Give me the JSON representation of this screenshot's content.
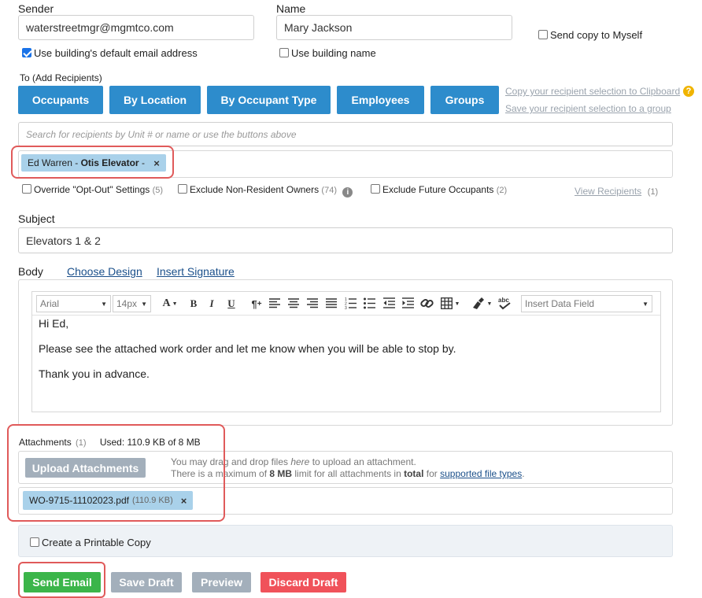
{
  "sender": {
    "label": "Sender",
    "email": "waterstreetmgr@mgmtco.com",
    "default_email_label": "Use building's default email address",
    "default_email_checked": true
  },
  "name": {
    "label": "Name",
    "value": "Mary Jackson",
    "use_building_label": "Use building name",
    "use_building_checked": false
  },
  "send_copy_label": "Send copy to Myself",
  "recipients": {
    "label": "To (Add Recipients)",
    "buttons": [
      "Occupants",
      "By Location",
      "By Occupant Type",
      "Employees",
      "Groups"
    ],
    "copy_link": "Copy your recipient selection to Clipboard",
    "save_link": "Save your recipient selection to a group",
    "help_glyph": "?",
    "search_placeholder": "Search for recipients by Unit # or name or use the buttons above",
    "chip": {
      "name": "Ed Warren",
      "sep": " - ",
      "company": "Otis Elevator",
      "tail": " - ",
      "remove": "×"
    },
    "options": [
      {
        "label": "Override \"Opt-Out\" Settings",
        "count": "(5)"
      },
      {
        "label": "Exclude Non-Resident Owners",
        "count": "(74)",
        "info": "i"
      },
      {
        "label": "Exclude Future Occupants",
        "count": "(2)"
      }
    ],
    "view_link": "View Recipients",
    "view_count": "(1)"
  },
  "subject": {
    "label": "Subject",
    "value": "Elevators 1 & 2"
  },
  "body": {
    "label": "Body",
    "choose_design": "Choose Design",
    "insert_signature": "Insert Signature",
    "font": "Arial",
    "size": "14px",
    "data_field": "Insert Data Field",
    "lines": [
      "Hi Ed,",
      "Please see the attached work order and let me know when you will be able to stop by.",
      "Thank you in advance."
    ]
  },
  "attachments": {
    "label": "Attachments",
    "count": "(1)",
    "used": "Used: 110.9 KB of 8 MB",
    "upload_button": "Upload Attachments",
    "hint1_a": "You may drag and drop files ",
    "hint1_b": "here",
    "hint1_c": " to upload an attachment.",
    "hint2_a": "There is a maximum of ",
    "hint2_b": "8 MB",
    "hint2_c": " limit for all attachments in ",
    "hint2_d": "total",
    "hint2_e": " for ",
    "hint2_link": "supported file types",
    "hint2_f": ".",
    "file_name": "WO-9715-11102023.pdf",
    "file_size": "(110.9 KB)",
    "remove": "×"
  },
  "printable_label": "Create a Printable Copy",
  "actions": {
    "send": "Send Email",
    "save": "Save Draft",
    "preview": "Preview",
    "discard": "Discard Draft"
  },
  "colors": {
    "primary_blue": "#2d8ccc",
    "send_green": "#3bb54a",
    "discard_red": "#f0525a",
    "muted_button": "#a3afbb",
    "chip_blue": "#a9d1ea",
    "highlight_red": "#e05a5a"
  }
}
